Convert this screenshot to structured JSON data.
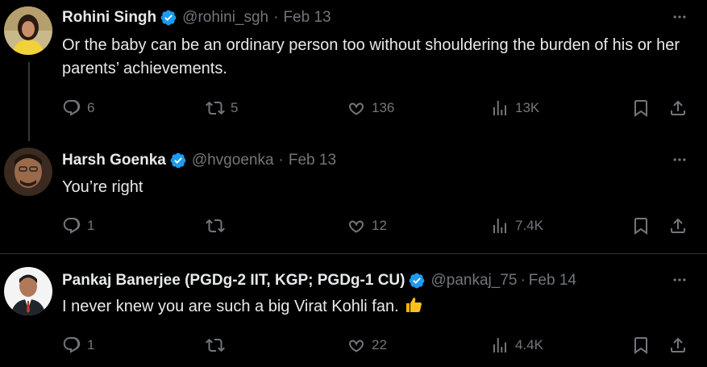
{
  "tweets": [
    {
      "name": "Rohini Singh",
      "handle": "@rohini_sgh",
      "separator": "·",
      "date": "Feb 13",
      "text": "Or the baby can be an ordinary person too without shouldering the burden of his or her parents’ achievements.",
      "replies": "6",
      "retweets": "5",
      "likes": "136",
      "views": "13K"
    },
    {
      "name": "Harsh Goenka",
      "handle": "@hvgoenka",
      "separator": "·",
      "date": "Feb 13",
      "text": "You’re right",
      "replies": "1",
      "retweets": "",
      "likes": "12",
      "views": "7.4K"
    },
    {
      "name": "Pankaj Banerjee (PGDg-2 IIT, KGP; PGDg-1 CU)",
      "handle": "@pankaj_75",
      "separator": "·",
      "date": "Feb 14",
      "text": "I never knew you are such a big Virat Kohli fan.",
      "emoji": "thumbs-up-emoji",
      "replies": "1",
      "retweets": "",
      "likes": "22",
      "views": "4.4K"
    }
  ],
  "colors": {
    "background": "#000000",
    "text": "#e7e9ea",
    "muted": "#71767b",
    "verified": "#1d9bf0"
  },
  "icons": [
    "verified-badge-icon",
    "more-icon",
    "reply-icon",
    "retweet-icon",
    "like-icon",
    "views-icon",
    "bookmark-icon",
    "share-icon"
  ]
}
